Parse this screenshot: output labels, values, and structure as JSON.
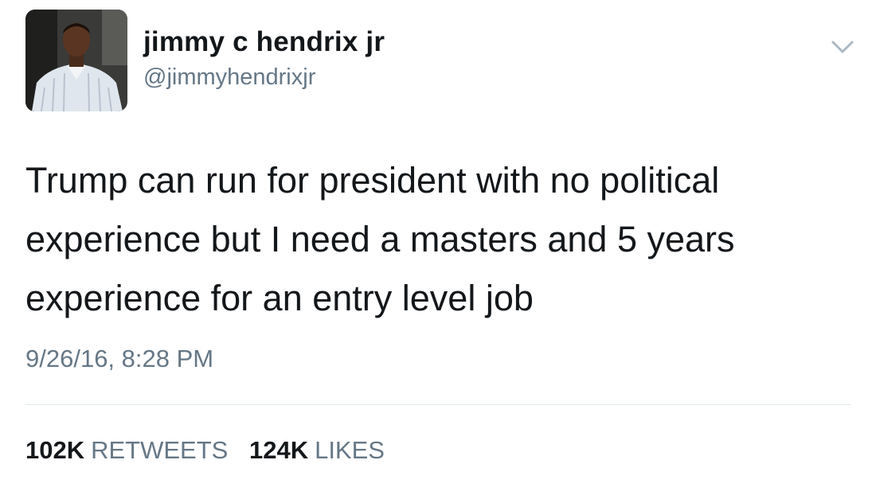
{
  "tweet": {
    "author": {
      "display_name": "jimmy c hendrix jr",
      "handle": "@jimmyhendrixjr"
    },
    "text": "Trump can run for president with no political\nexperience but I need a masters and 5 years\nexperience for an entry level job",
    "timestamp": "9/26/16, 8:28 PM",
    "stats": {
      "retweets_count": "102K",
      "retweets_label": "RETWEETS",
      "likes_count": "124K",
      "likes_label": "LIKES"
    }
  },
  "icons": {
    "menu": "chevron-down-icon"
  },
  "colors": {
    "text_primary": "#14171a",
    "text_secondary": "#657786",
    "divider": "#e1e8ed",
    "background": "#ffffff"
  }
}
